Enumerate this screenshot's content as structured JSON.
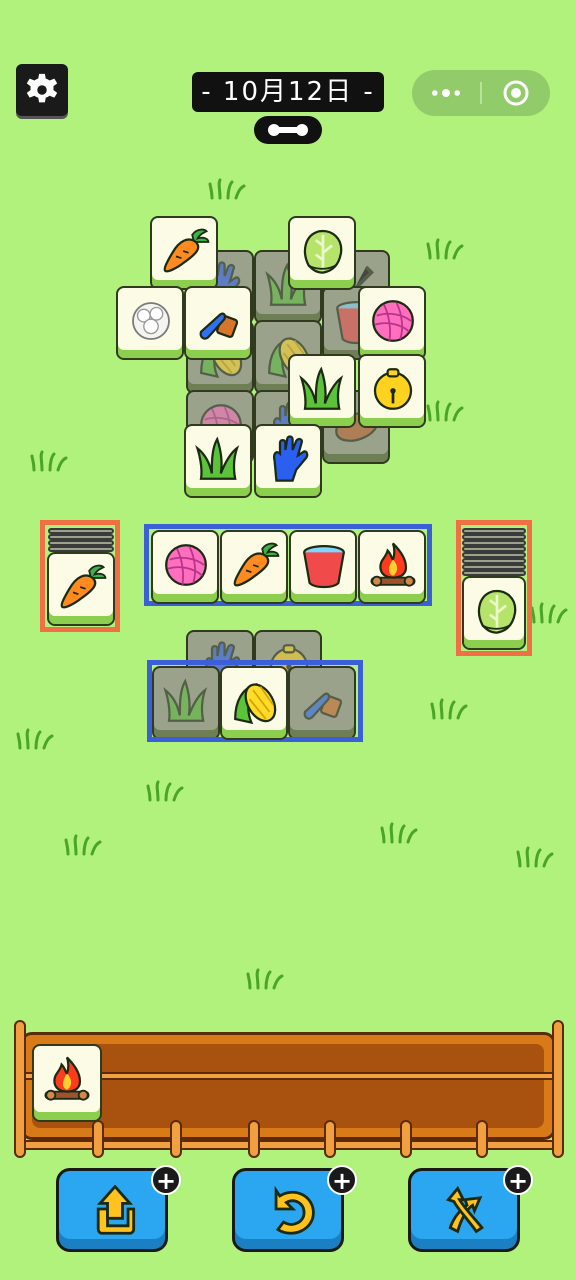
{
  "header": {
    "date_label": "- 10月12日 -",
    "settings_icon": "gear-icon",
    "menu_icon": "more-dots-icon",
    "close_icon": "target-circle-icon",
    "link_icon": "link-connector-icon"
  },
  "board": {
    "top_tiles": [
      "carrot",
      "napa-cabbage",
      "cotton",
      "paintbrush",
      "yarn-ball",
      "grass",
      "bell",
      "grass",
      "glove"
    ],
    "hidden_tiles": [
      "glove",
      "grass",
      "shovel",
      "bucket",
      "corn",
      "yarn-ball",
      "glove",
      "cabbage",
      "sweet-potato"
    ]
  },
  "left_stack": {
    "top_tile": "carrot"
  },
  "right_stack": {
    "top_tile": "napa-cabbage"
  },
  "middle_row": [
    "yarn-ball",
    "carrot",
    "bucket",
    "campfire"
  ],
  "bottom_group": {
    "top_tile": "corn",
    "hidden": [
      "glove",
      "grass",
      "paintbrush",
      "bell"
    ]
  },
  "tray": {
    "tiles": [
      "campfire"
    ],
    "capacity": 7
  },
  "tools": [
    {
      "name": "move-out",
      "icon": "box-arrow-up-icon",
      "badge": "+"
    },
    {
      "name": "undo",
      "icon": "undo-arrow-icon",
      "badge": "+"
    },
    {
      "name": "shuffle",
      "icon": "shuffle-arrows-icon",
      "badge": "+"
    }
  ],
  "colors": {
    "background": "#b0f27c",
    "frame_red": "#f26f45",
    "frame_blue": "#3b5fd9",
    "tray_wood": "#b55a12",
    "button_blue": "#2aa7f0"
  }
}
